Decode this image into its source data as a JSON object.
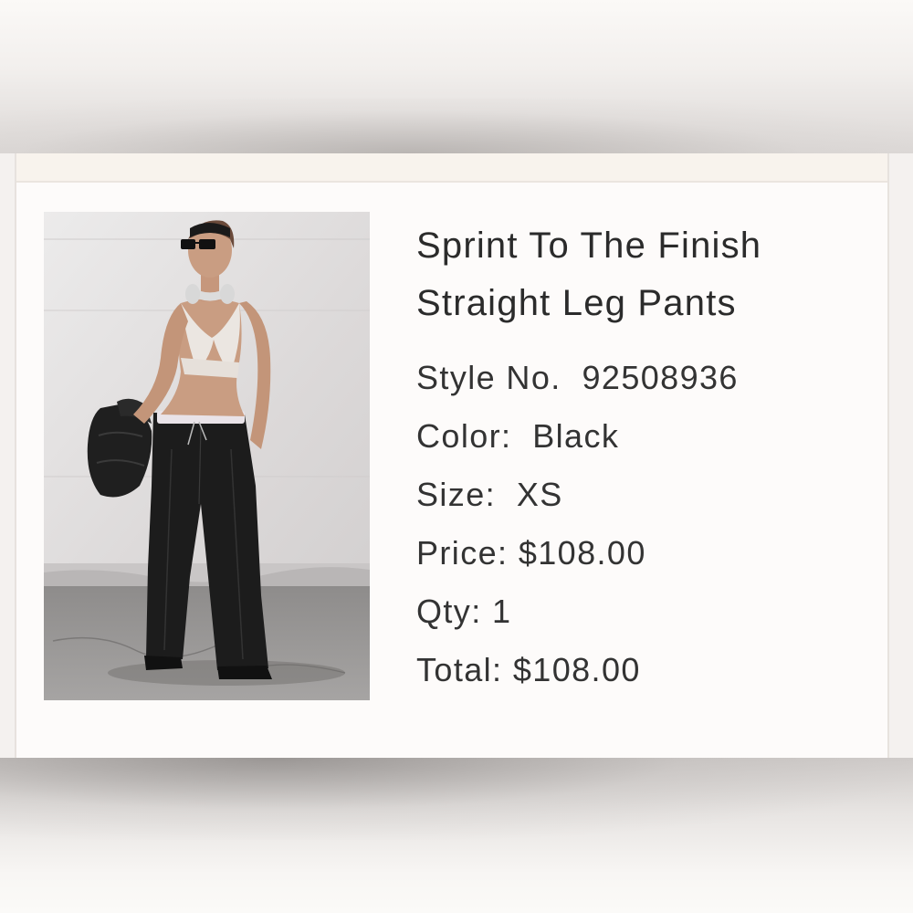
{
  "product": {
    "title": "Sprint To The Finish Straight Leg Pants",
    "image_alt": "Model wearing black straight leg sweatpants, white bralette, headband and headphones",
    "details": [
      {
        "label": "Style No.",
        "sep": "  ",
        "value": "92508936"
      },
      {
        "label": "Color:",
        "sep": "  ",
        "value": "Black"
      },
      {
        "label": "Size:",
        "sep": "  ",
        "value": "XS"
      },
      {
        "label": "Price:",
        "sep": " ",
        "value": "$108.00"
      },
      {
        "label": "Qty:",
        "sep": " ",
        "value": "1"
      },
      {
        "label": "Total:",
        "sep": " ",
        "value": "$108.00"
      }
    ]
  }
}
